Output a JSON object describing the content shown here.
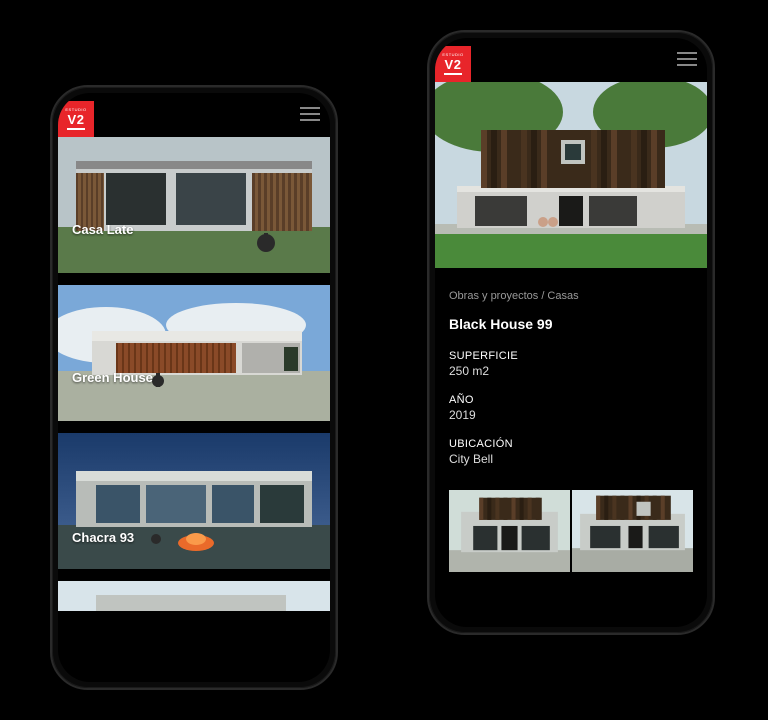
{
  "brand": {
    "small": "ESTUDIO",
    "main": "V2"
  },
  "colors": {
    "accent": "#e8252a"
  },
  "left_phone": {
    "projects": [
      {
        "title": "Casa Late"
      },
      {
        "title": "Green House"
      },
      {
        "title": "Chacra 93"
      }
    ]
  },
  "right_phone": {
    "breadcrumb": "Obras y proyectos / Casas",
    "title": "Black House 99",
    "fields": [
      {
        "label": "SUPERFICIE",
        "value": "250 m2"
      },
      {
        "label": "AÑO",
        "value": "2019"
      },
      {
        "label": "UBICACIÓN",
        "value": "City Bell"
      }
    ]
  }
}
